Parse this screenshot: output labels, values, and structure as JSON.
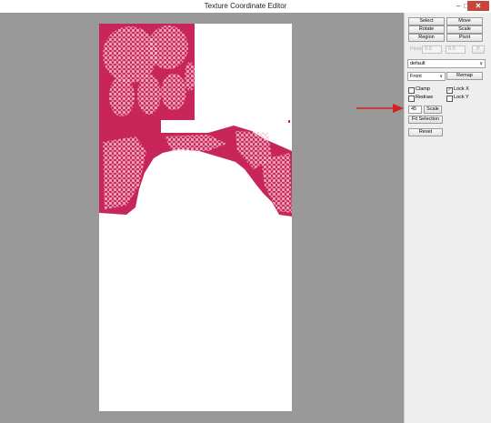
{
  "window": {
    "title": "Texture Coordinate Editor",
    "min_glyph": "–",
    "max_glyph": "□",
    "close_glyph": "✕"
  },
  "panel": {
    "buttons": {
      "select": "Select",
      "move": "Move",
      "rotate": "Rotate",
      "scale": "Scale",
      "region": "Region",
      "pivot": "Pivot",
      "remap": "Remap",
      "scale_small": "Scale",
      "fit_selection": "Fit Selection",
      "reset": "Reset"
    },
    "pivot_label": "Pivot:",
    "pivot_x": "0.0",
    "pivot_y": "0.0",
    "pivot_btn": "P",
    "material_select": "default",
    "view_select": "Front",
    "clamp_label": "Clamp",
    "redraw_label": "Redraw",
    "lock_x_label": "Lock X",
    "lock_y_label": "Lock Y",
    "lock_x_checked": true,
    "scale_value": "45"
  },
  "colors": {
    "uv_fill": "#c8265a",
    "uv_wire": "#f3b8c6",
    "arrow": "#d82020",
    "canvas_bg": "#999999"
  }
}
